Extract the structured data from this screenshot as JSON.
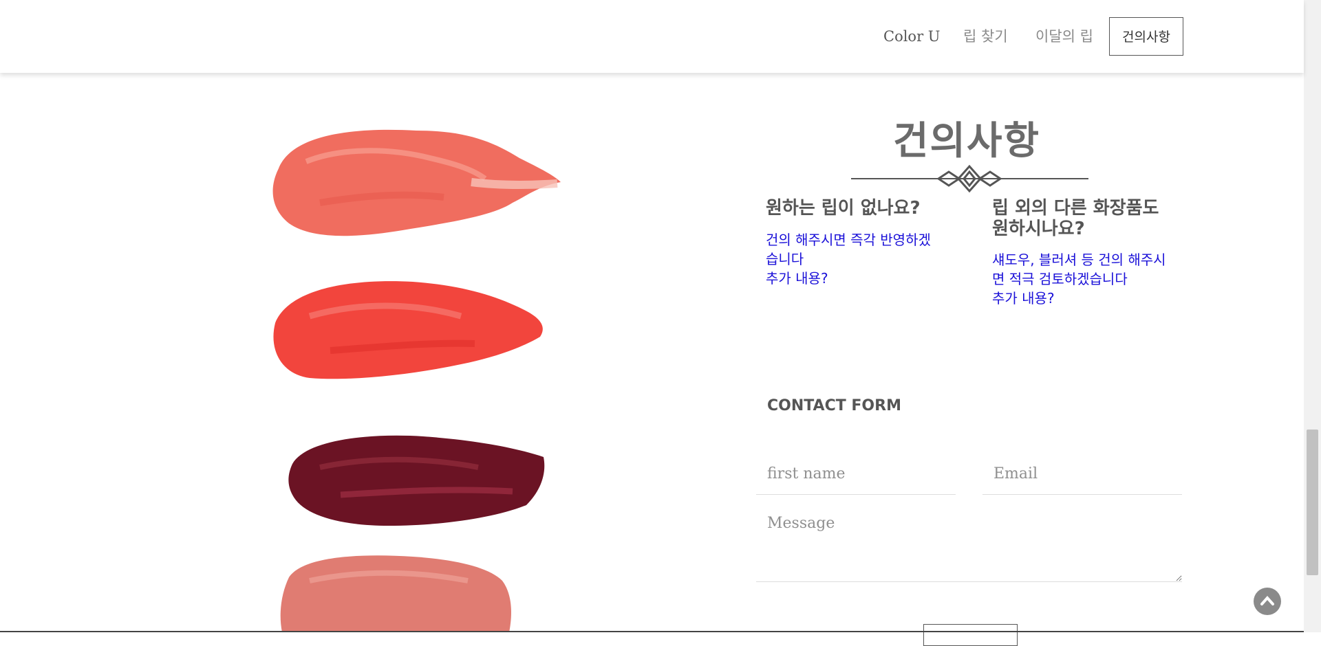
{
  "nav": {
    "brand": "Color U",
    "items": [
      "립 찾기",
      "이달의 립"
    ],
    "active": "건의사항"
  },
  "section": {
    "title": "건의사항",
    "col1": {
      "heading": "원하는 립이 없나요?",
      "text": "건의 해주시면 즉각 반영하겠\n습니다\n추가 내용?"
    },
    "col2": {
      "heading": "립 외의 다른 화장품도\n원하시나요?",
      "text": "섀도우, 블러셔 등 건의 해주시\n면 적극 검토하겠습니다\n추가 내용?"
    }
  },
  "contact": {
    "label": "CONTACT FORM",
    "first_name_placeholder": "first name",
    "email_placeholder": "Email",
    "message_placeholder": "Message"
  },
  "icons": {
    "to_top": "chevron-up-icon",
    "ornament": "ornament-divider-icon"
  },
  "colors": {
    "swatch_1": "#f06d5f",
    "swatch_2": "#f2453d",
    "swatch_3": "#6b1324",
    "swatch_4": "#e07c72",
    "link_text": "#1a10d8"
  }
}
